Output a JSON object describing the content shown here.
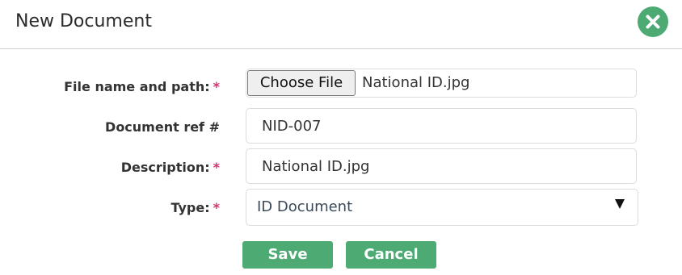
{
  "dialog": {
    "title": "New Document",
    "close_icon": "close-icon",
    "accent_color": "#4caa72",
    "required_color": "#d2306e"
  },
  "form": {
    "file": {
      "label": "File name and path:",
      "required_marker": "*",
      "button_label": "Choose File",
      "file_name": "National ID.jpg"
    },
    "document_ref": {
      "label": "Document ref #",
      "value": "NID-007"
    },
    "description": {
      "label": "Description:",
      "required_marker": "*",
      "value": "National ID.jpg"
    },
    "type": {
      "label": "Type:",
      "required_marker": "*",
      "selected": "ID Document",
      "arrow_icon": "dropdown-arrow-icon"
    }
  },
  "actions": {
    "save_label": "Save",
    "cancel_label": "Cancel"
  }
}
